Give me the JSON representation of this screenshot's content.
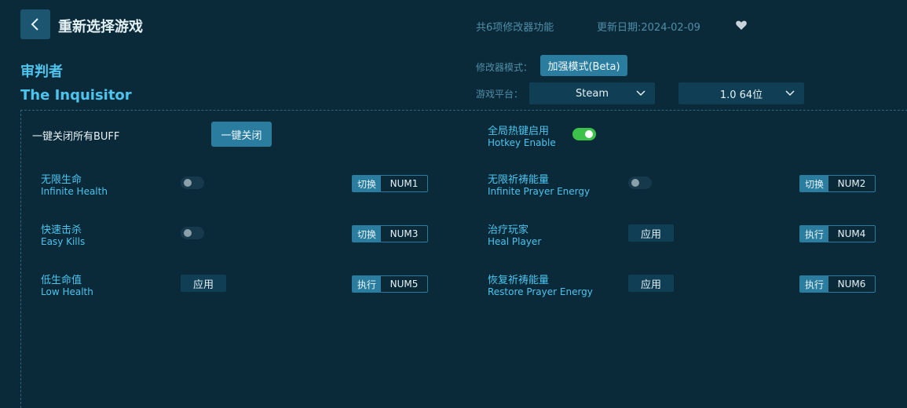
{
  "header": {
    "title": "重新选择游戏",
    "feature_count": "共6项修改器功能",
    "update_date": "更新日期:2024-02-09"
  },
  "game": {
    "title_cn": "审判者",
    "title_en": "The Inquisitor"
  },
  "settings": {
    "mode_label": "修改器模式：",
    "mode_value": "加强模式(Beta)",
    "platform_label": "游戏平台：",
    "platform_value": "Steam",
    "version_value": "1.0 64位"
  },
  "panel": {
    "buff_label": "一键关闭所有BUFF",
    "close_all_label": "一键关闭",
    "hotkey_cn": "全局热键启用",
    "hotkey_en": "Hotkey Enable",
    "hotkey_enabled": true
  },
  "options": [
    {
      "cn": "无限生命",
      "en": "Infinite Health",
      "control": "toggle",
      "on": false,
      "action": "切换",
      "key": "NUM1"
    },
    {
      "cn": "无限祈祷能量",
      "en": "Infinite Prayer Energy",
      "control": "toggle",
      "on": false,
      "action": "切换",
      "key": "NUM2"
    },
    {
      "cn": "快速击杀",
      "en": "Easy Kills",
      "control": "toggle",
      "on": false,
      "action": "切换",
      "key": "NUM3"
    },
    {
      "cn": "治疗玩家",
      "en": "Heal Player",
      "control": "apply",
      "apply_label": "应用",
      "action": "执行",
      "key": "NUM4"
    },
    {
      "cn": "低生命值",
      "en": "Low Health",
      "control": "apply",
      "apply_label": "应用",
      "action": "执行",
      "key": "NUM5"
    },
    {
      "cn": "恢复祈祷能量",
      "en": "Restore Prayer Energy",
      "control": "apply",
      "apply_label": "应用",
      "action": "执行",
      "key": "NUM6"
    }
  ],
  "icons": {
    "back": "chevron-left-icon",
    "favorite": "heart-icon",
    "dropdown": "chevron-down-icon"
  },
  "colors": {
    "background": "#0b2a39",
    "accent": "#2a7d9f",
    "title": "#4cc4ee",
    "toggle_on": "#3cc24a"
  }
}
